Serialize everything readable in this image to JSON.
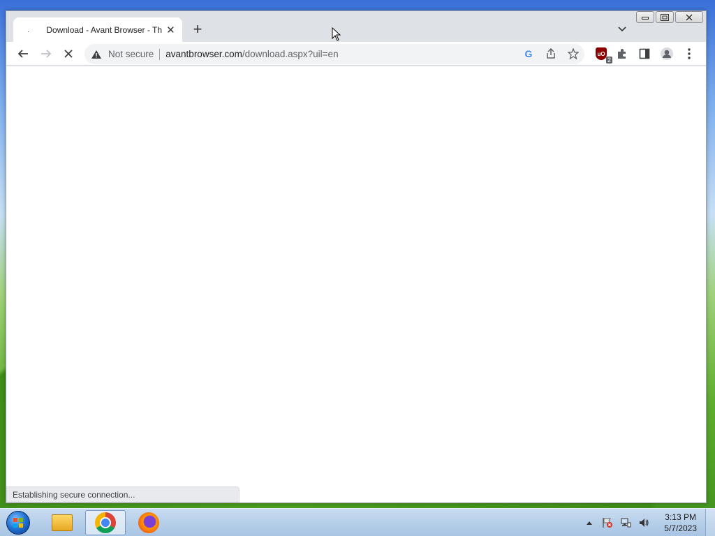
{
  "browser": {
    "tab": {
      "title": "Download - Avant Browser - The",
      "spinner_glyph": "·",
      "close_glyph": "✕"
    },
    "new_tab_glyph": "+",
    "tab_search_glyph": "⌄",
    "window_controls": {
      "minimize": "▭",
      "maximize": "❐",
      "close": "✕"
    },
    "toolbar": {
      "back_glyph": "←",
      "forward_glyph": "→",
      "stop_glyph": "✕",
      "security_label": "Not secure",
      "url_host": "avantbrowser.com",
      "url_path": "/download.aspx?uil=en",
      "extension_badge_count": "2",
      "google_glyph": "G"
    },
    "icons": {
      "warning": "warning-triangle-icon",
      "share": "share-icon",
      "star": "star-icon",
      "extension": "puzzle-icon",
      "sidepanel": "side-panel-icon",
      "profile": "profile-icon",
      "menu": "kebab-menu-icon"
    },
    "status_text": "Establishing secure connection..."
  },
  "taskbar": {
    "apps": [
      "file-explorer",
      "google-chrome",
      "firefox"
    ],
    "active_app": "google-chrome",
    "clock": {
      "time": "3:13 PM",
      "date": "5/7/2023"
    }
  },
  "colors": {
    "tabstrip": "#dee1e6",
    "omnibox": "#f1f3f4",
    "taskbar": "#b6cfe9"
  }
}
